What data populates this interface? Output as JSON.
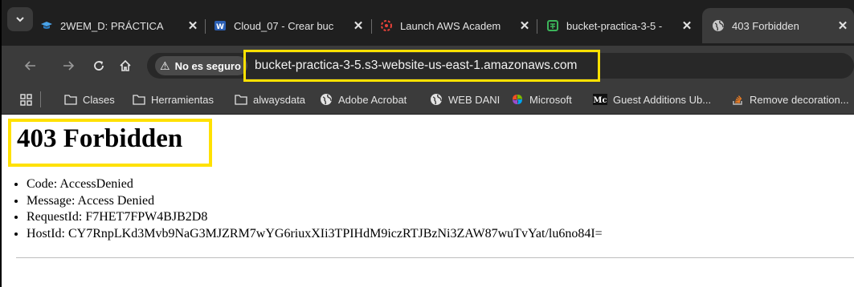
{
  "tabs": [
    {
      "title": "2WEM_D: PRÁCTICA",
      "icon": "hat-icon"
    },
    {
      "title": "Cloud_07 - Crear buc",
      "icon": "word-icon"
    },
    {
      "title": "Launch AWS Academ",
      "icon": "aws-academy-icon"
    },
    {
      "title": "bucket-practica-3-5 -",
      "icon": "sheets-icon"
    },
    {
      "title": "403 Forbidden",
      "icon": "globe-icon"
    }
  ],
  "toolbar": {
    "security_label": "No es seguro",
    "url": "bucket-practica-3-5.s3-website-us-east-1.amazonaws.com"
  },
  "bookmarks": [
    {
      "label": "Clases",
      "icon": "folder-icon"
    },
    {
      "label": "Herramientas",
      "icon": "folder-icon"
    },
    {
      "label": "alwaysdata",
      "icon": "folder-icon"
    },
    {
      "label": "Adobe Acrobat",
      "icon": "globe-icon"
    },
    {
      "label": "WEB DANI",
      "icon": "globe-icon"
    },
    {
      "label": "Microsoft",
      "icon": "microsoft-icon"
    },
    {
      "label": "Guest Additions Ub...",
      "icon": "mc-icon"
    },
    {
      "label": "Remove decoration...",
      "icon": "stackoverflow-icon"
    }
  ],
  "page": {
    "title": "403 Forbidden",
    "details": [
      "Code: AccessDenied",
      "Message: Access Denied",
      "RequestId: F7HET7FPW4BJB2D8",
      "HostId: CY7RnpLKd3Mvb9NaG3MJZRM7wYG6riuxXIi3TPIHdM9iczRTJBzNi3ZAW87wuTvYat/lu6no84I="
    ]
  },
  "colors": {
    "highlight": "#ffe100",
    "tabstrip": "#1f1f1f",
    "toolbar": "#3b3b3b"
  }
}
